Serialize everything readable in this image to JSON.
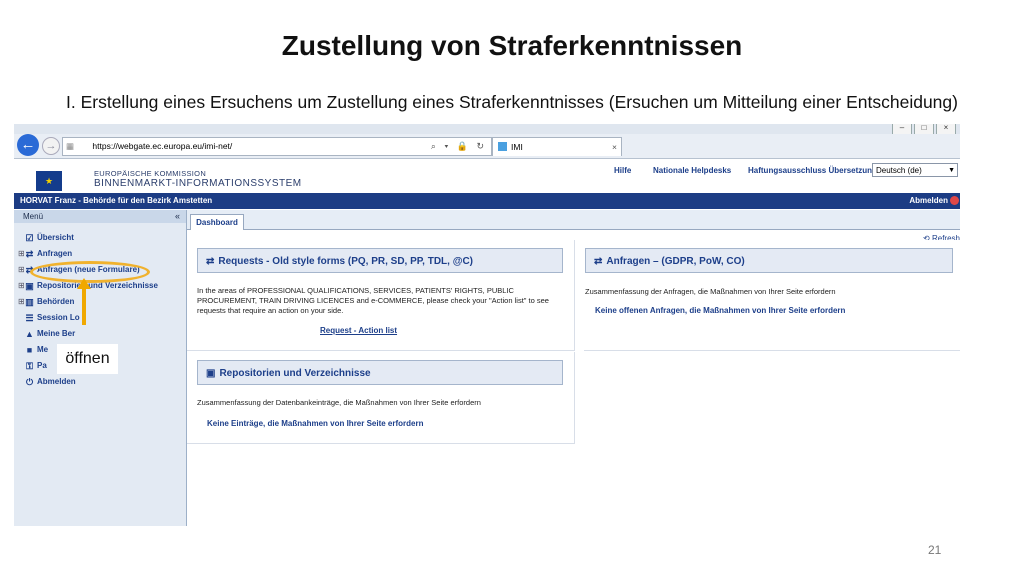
{
  "slide": {
    "title": "Zustellung von Straferkenntnissen",
    "subtitle": "I. Erstellung eines Ersuchens um Zustellung eines Straferkenntnisses (Ersuchen um Mitteilung einer Entscheidung)",
    "page_number": "21",
    "callout": "öffnen"
  },
  "browser": {
    "url": "https://webgate.ec.europa.eu/imi-net/",
    "tab_title": "IMI"
  },
  "site": {
    "org_line1": "EUROPÄISCHE KOMMISSION",
    "org_line2": "BINNENMARKT-INFORMATIONSSYSTEM",
    "links": [
      "Hilfe",
      "Nationale Helpdesks",
      "Haftungsausschluss Übersetzung"
    ],
    "language": "Deutsch (de)",
    "user": "HORVAT Franz - Behörde für den Bezirk Amstetten",
    "logout": "Abmelden"
  },
  "sidebar": {
    "title": "Menü",
    "collapse": "«",
    "items": [
      {
        "label": "Übersicht",
        "icon": "checklist-icon"
      },
      {
        "label": "Anfragen",
        "icon": "exchange-icon"
      },
      {
        "label": "Anfragen (neue Formulare)",
        "icon": "exchange-icon"
      },
      {
        "label": "Repositorien und Verzeichnisse",
        "icon": "box-icon"
      },
      {
        "label": "Behörden",
        "icon": "building-icon"
      },
      {
        "label": "Session Lo",
        "icon": "list-icon"
      },
      {
        "label": "Meine Ber",
        "icon": "user-icon"
      },
      {
        "label": "Me",
        "icon": "chat-icon"
      },
      {
        "label": "Pa",
        "icon": "key-icon"
      },
      {
        "label": "Abmelden",
        "icon": "power-icon"
      }
    ]
  },
  "content": {
    "tab": "Dashboard",
    "refresh": "Refresh",
    "panels": [
      {
        "title": "Requests - Old style forms (PQ, PR, SD, PP, TDL, @C)",
        "body": "In the areas of PROFESSIONAL QUALIFICATIONS, SERVICES, PATIENTS' RIGHTS, PUBLIC PROCUREMENT, TRAIN DRIVING LICENCES and e-COMMERCE, please check your \"Action list\" to see requests that require an action on your side.",
        "link": "Request - Action list"
      },
      {
        "title": "Anfragen – (GDPR, PoW, CO)",
        "body": "Zusammenfassung der Anfragen, die Maßnahmen von Ihrer Seite erfordern",
        "link": "Keine offenen Anfragen, die Maßnahmen von Ihrer Seite erfordern"
      },
      {
        "title": "Repositorien und Verzeichnisse",
        "body": "Zusammenfassung der Datenbankeinträge, die Maßnahmen von Ihrer Seite erfordern",
        "link": "Keine Einträge, die Maßnahmen von Ihrer Seite erfordern"
      }
    ]
  },
  "colors": {
    "accent": "#1c3c84",
    "highlight": "#f0b22e"
  }
}
